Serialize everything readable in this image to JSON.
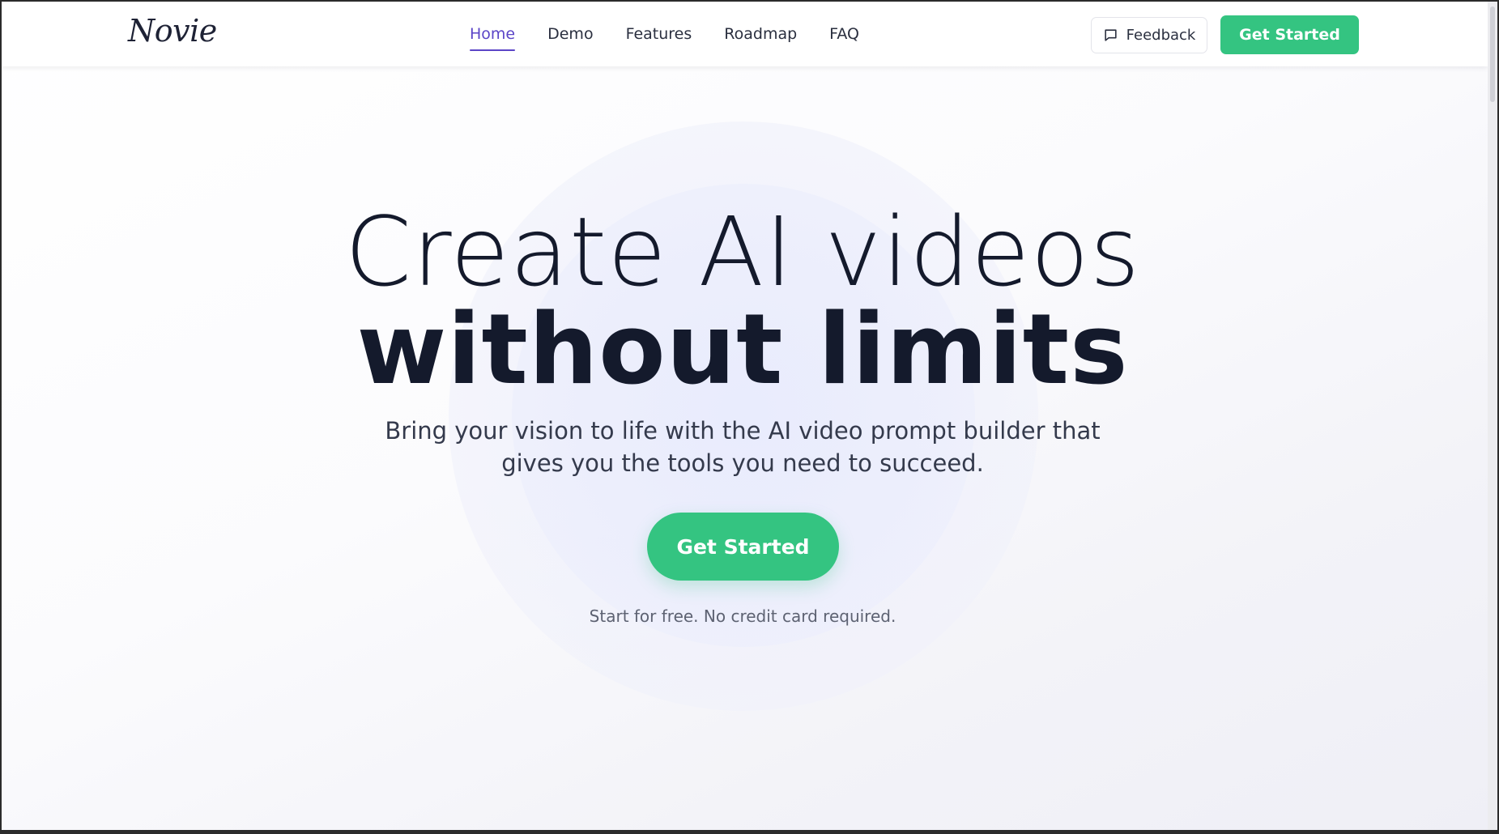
{
  "nav": {
    "logo": "Novie",
    "links": [
      {
        "label": "Home",
        "active": true
      },
      {
        "label": "Demo",
        "active": false
      },
      {
        "label": "Features",
        "active": false
      },
      {
        "label": "Roadmap",
        "active": false
      },
      {
        "label": "FAQ",
        "active": false
      }
    ],
    "feedback_label": "Feedback",
    "feedback_icon": "chat-bubble-icon",
    "cta_label": "Get Started"
  },
  "hero": {
    "headline_line1": "Create AI videos",
    "headline_line2": "without limits",
    "subtitle": "Bring your vision to life with the AI video prompt builder that gives you the tools you need to succeed.",
    "cta_label": "Get Started",
    "fineprint": "Start for free. No credit card required."
  },
  "colors": {
    "accent_purple": "#5b45c7",
    "brand_green": "#34c481",
    "heading_text": "#141a2c"
  }
}
